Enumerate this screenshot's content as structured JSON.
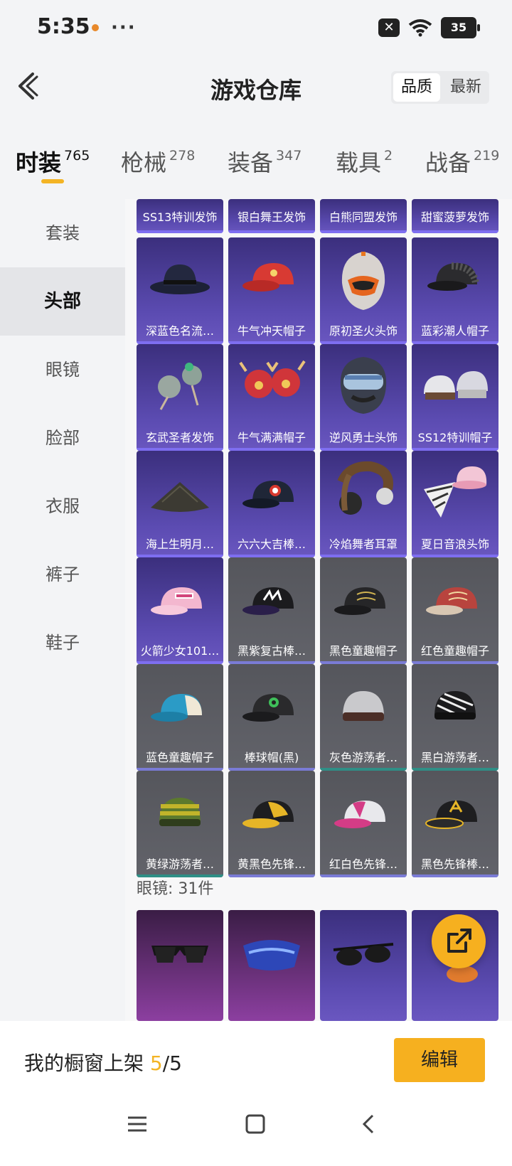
{
  "status": {
    "time": "5:35",
    "dots": "···",
    "battery": "35"
  },
  "header": {
    "title": "游戏仓库",
    "sort": [
      "品质",
      "最新"
    ]
  },
  "tabs": [
    {
      "label": "时装",
      "count": "765",
      "active": true
    },
    {
      "label": "枪械",
      "count": "278"
    },
    {
      "label": "装备",
      "count": "347"
    },
    {
      "label": "载具",
      "count": "2"
    },
    {
      "label": "战备",
      "count": "219"
    }
  ],
  "sidebar": [
    "套装",
    "头部",
    "眼镜",
    "脸部",
    "衣服",
    "裤子",
    "鞋子"
  ],
  "grid": {
    "top_row": [
      "SS13特训发饰",
      "银白舞王发饰",
      "白熊同盟发饰",
      "甜蜜菠萝发饰"
    ],
    "rows": [
      [
        "深蓝色名流…",
        "牛气冲天帽子",
        "原初圣火头饰",
        "蓝彩潮人帽子"
      ],
      [
        "玄武圣者发饰",
        "牛气满满帽子",
        "逆风勇士头饰",
        "SS12特训帽子"
      ],
      [
        "海上生明月…",
        "六六大吉棒…",
        "冷焰舞者耳罩",
        "夏日音浪头饰"
      ],
      [
        "火箭少女101…",
        "黑紫复古棒…",
        "黑色童趣帽子",
        "红色童趣帽子"
      ],
      [
        "蓝色童趣帽子",
        "棒球帽(黑)",
        "灰色游荡者…",
        "黑白游荡者…"
      ],
      [
        "黄绿游荡者…",
        "黄黑色先锋…",
        "红白色先锋…",
        "黑色先锋棒…"
      ]
    ]
  },
  "glasses_section": "眼镜: 31件",
  "footer": {
    "showcase_prefix": "我的橱窗上架 ",
    "showcase_used": "5",
    "showcase_total": "/5",
    "edit": "编辑"
  },
  "icons": [
    "back-icon",
    "share-icon",
    "menu-icon",
    "home-icon",
    "nav-back-icon"
  ],
  "colors": {
    "accent": "#f6b01f",
    "purple_card": "#5b4bb1",
    "gray_card": "#5d5e64"
  }
}
